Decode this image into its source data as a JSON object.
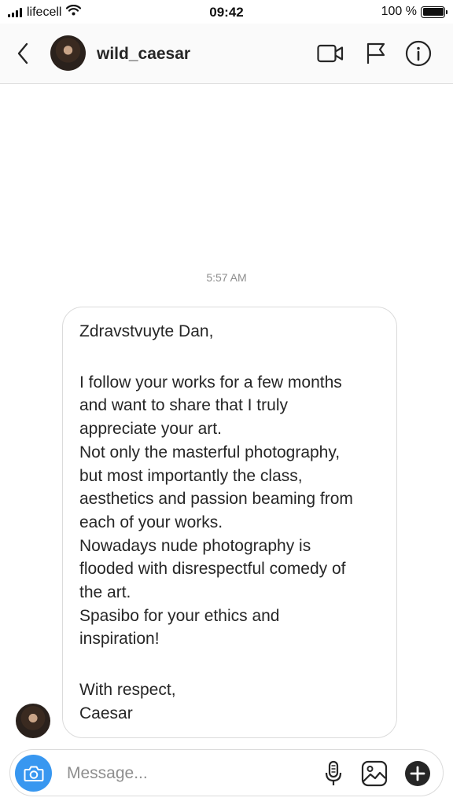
{
  "status_bar": {
    "carrier": "lifecell",
    "time": "09:42",
    "battery_text": "100 %",
    "battery_level": 1.0,
    "signal_icon": "signal-bars-icon",
    "wifi_icon": "wifi-icon"
  },
  "header": {
    "back_icon": "chevron-left-icon",
    "username": "wild_caesar",
    "actions": [
      "video-camera-icon",
      "flag-icon",
      "info-icon"
    ]
  },
  "chat": {
    "timestamp": "5:57 AM",
    "message": {
      "greeting": "Zdravstvuyte Dan,",
      "body_lines": [
        "I follow your works for a few months",
        "and want to share that I truly",
        "appreciate your art.",
        "Not only the masterful photography,",
        "but most importantly the class,",
        "aesthetics and passion beaming from",
        "each of your works.",
        "Nowadays nude photography is",
        "flooded with disrespectful comedy of",
        "the art.",
        "Spasibo for your ethics and",
        "inspiration!"
      ],
      "closing_lines": [
        "With respect,",
        "Caesar"
      ]
    }
  },
  "composer": {
    "placeholder": "Message...",
    "camera_icon": "camera-icon",
    "mic_icon": "microphone-icon",
    "gallery_icon": "gallery-icon",
    "plus_icon": "plus-circle-icon"
  },
  "colors": {
    "accent": "#3897f0",
    "text": "#262626",
    "muted": "#8e8e8e",
    "border": "#dbdbdb"
  }
}
